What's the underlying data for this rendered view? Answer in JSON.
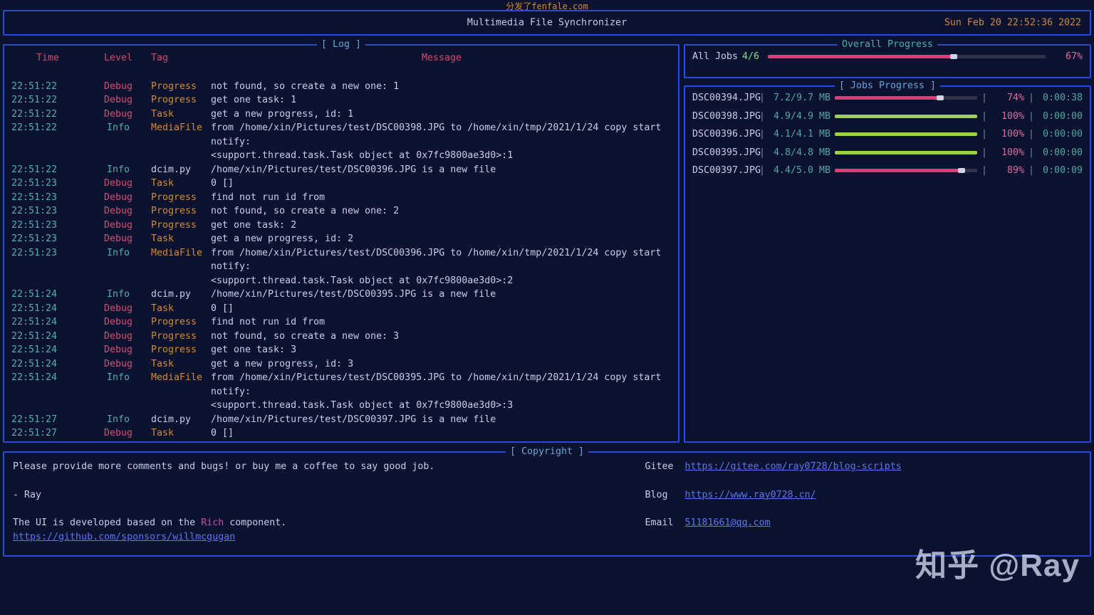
{
  "top_url": "分发了fenfale.com",
  "header": {
    "title": "Multimedia File Synchronizer",
    "clock": "Sun Feb 20 22:52:36 2022"
  },
  "panels": {
    "log_title": "[ Log ]",
    "overall_title": "Overall Progress",
    "jobs_title": "[ Jobs Progress ]",
    "copyright_title": "[ Copyright ]"
  },
  "log": {
    "headers": {
      "time": "Time",
      "level": "Level",
      "tag": "Tag",
      "message": "Message"
    },
    "rows": [
      {
        "time": "22:51:22",
        "level": "Debug",
        "tag": "Progress",
        "msg": "not found, so create a new one: 1"
      },
      {
        "time": "22:51:22",
        "level": "Debug",
        "tag": "Progress",
        "msg": "get one task: 1"
      },
      {
        "time": "22:51:22",
        "level": "Debug",
        "tag": "Task",
        "msg": "get a new progress, id: 1"
      },
      {
        "time": "22:51:22",
        "level": "Info",
        "tag": "MediaFile",
        "msg": "from /home/xin/Pictures/test/DSC00398.JPG to /home/xin/tmp/2021/1/24 copy start notify:\n<support.thread.task.Task object at 0x7fc9800ae3d0>:1"
      },
      {
        "time": "22:51:22",
        "level": "Info",
        "tag": "dcim.py",
        "msg": "/home/xin/Pictures/test/DSC00396.JPG is a new file"
      },
      {
        "time": "22:51:23",
        "level": "Debug",
        "tag": "Task",
        "msg": "0 []"
      },
      {
        "time": "22:51:23",
        "level": "Debug",
        "tag": "Progress",
        "msg": "find not run id from"
      },
      {
        "time": "22:51:23",
        "level": "Debug",
        "tag": "Progress",
        "msg": "not found, so create a new one: 2"
      },
      {
        "time": "22:51:23",
        "level": "Debug",
        "tag": "Progress",
        "msg": "get one task: 2"
      },
      {
        "time": "22:51:23",
        "level": "Debug",
        "tag": "Task",
        "msg": "get a new progress, id: 2"
      },
      {
        "time": "22:51:23",
        "level": "Info",
        "tag": "MediaFile",
        "msg": "from /home/xin/Pictures/test/DSC00396.JPG to /home/xin/tmp/2021/1/24 copy start notify:\n<support.thread.task.Task object at 0x7fc9800ae3d0>:2"
      },
      {
        "time": "22:51:24",
        "level": "Info",
        "tag": "dcim.py",
        "msg": "/home/xin/Pictures/test/DSC00395.JPG is a new file"
      },
      {
        "time": "22:51:24",
        "level": "Debug",
        "tag": "Task",
        "msg": "0 []"
      },
      {
        "time": "22:51:24",
        "level": "Debug",
        "tag": "Progress",
        "msg": "find not run id from"
      },
      {
        "time": "22:51:24",
        "level": "Debug",
        "tag": "Progress",
        "msg": "not found, so create a new one: 3"
      },
      {
        "time": "22:51:24",
        "level": "Debug",
        "tag": "Progress",
        "msg": "get one task: 3"
      },
      {
        "time": "22:51:24",
        "level": "Debug",
        "tag": "Task",
        "msg": "get a new progress, id: 3"
      },
      {
        "time": "22:51:24",
        "level": "Info",
        "tag": "MediaFile",
        "msg": "from /home/xin/Pictures/test/DSC00395.JPG to /home/xin/tmp/2021/1/24 copy start notify:\n<support.thread.task.Task object at 0x7fc9800ae3d0>:3"
      },
      {
        "time": "22:51:27",
        "level": "Info",
        "tag": "dcim.py",
        "msg": "/home/xin/Pictures/test/DSC00397.JPG is a new file"
      },
      {
        "time": "22:51:27",
        "level": "Debug",
        "tag": "Task",
        "msg": "0 []"
      }
    ]
  },
  "overall": {
    "label": "All Jobs",
    "count": "4/6",
    "pct": 67
  },
  "jobs": [
    {
      "name": "DSC00394.JPG",
      "size": "7.2/9.7 MB",
      "pct": 74,
      "eta": "0:00:38",
      "color": "pink"
    },
    {
      "name": "DSC00398.JPG",
      "size": "4.9/4.9 MB",
      "pct": 100,
      "eta": "0:00:00",
      "color": "green"
    },
    {
      "name": "DSC00396.JPG",
      "size": "4.1/4.1 MB",
      "pct": 100,
      "eta": "0:00:00",
      "color": "green"
    },
    {
      "name": "DSC00395.JPG",
      "size": "4.8/4.8 MB",
      "pct": 100,
      "eta": "0:00:00",
      "color": "green"
    },
    {
      "name": "DSC00397.JPG",
      "size": "4.4/5.0 MB",
      "pct": 89,
      "eta": "0:00:09",
      "color": "pink"
    }
  ],
  "copyright": {
    "line1": "Please provide more comments and bugs! or buy me a coffee to say good job.",
    "signature": "- Ray",
    "dev_prefix": "The UI is developed based on the ",
    "dev_rich": "Rich",
    "dev_suffix": " component.",
    "sponsor_url": "https://github.com/sponsors/willmcgugan",
    "links": {
      "gitee_label": "Gitee",
      "gitee_url": "https://gitee.com/ray0728/blog-scripts",
      "blog_label": "Blog",
      "blog_url": "https://www.ray0728.cn/",
      "email_label": "Email",
      "email_url": "51181661@qq.com"
    }
  },
  "watermark": "知乎 @Ray"
}
